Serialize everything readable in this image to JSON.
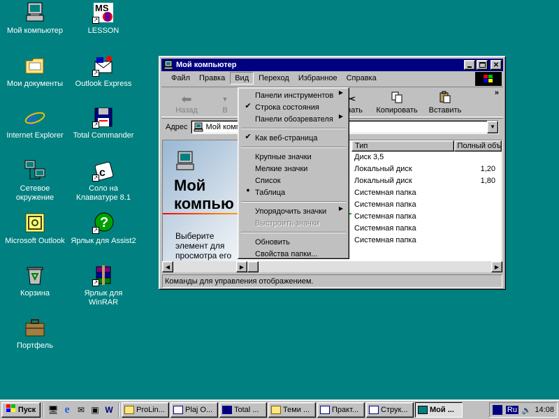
{
  "desktop": {
    "icons": [
      {
        "label": "Мой компьютер",
        "icon": "computer-icon"
      },
      {
        "label": "LESSON",
        "icon": "ms-office-icon"
      },
      {
        "label": "Мои документы",
        "icon": "folder-icon"
      },
      {
        "label": "Outlook Express",
        "icon": "outlook-express-icon"
      },
      {
        "label": "Internet Explorer",
        "icon": "ie-icon"
      },
      {
        "label": "Total Commander",
        "icon": "floppy-icon"
      },
      {
        "label": "Сетевое окружение",
        "icon": "network-icon"
      },
      {
        "label": "Соло на Клавиатуре 8.1",
        "icon": "keyboard-icon"
      },
      {
        "label": "Microsoft Outlook",
        "icon": "outlook-icon"
      },
      {
        "label": "Ярлык для Assist2",
        "icon": "help-icon"
      },
      {
        "label": "Корзина",
        "icon": "recycle-bin-icon"
      },
      {
        "label": "Ярлык для WinRAR",
        "icon": "winrar-icon"
      },
      {
        "label": "Портфель",
        "icon": "briefcase-icon"
      }
    ],
    "ms_logo_text": "MS"
  },
  "window": {
    "title": "Мой компьютер",
    "menu": [
      "Файл",
      "Правка",
      "Вид",
      "Переход",
      "Избранное",
      "Справка"
    ],
    "toolbar": {
      "back": "Назад",
      "forward_partial": "В",
      "cut_partial": "резать",
      "copy": "Копировать",
      "paste": "Вставить",
      "more": "»"
    },
    "address": {
      "label": "Адрес",
      "value": "Мой комп"
    },
    "webview": {
      "title_line1": "Мой",
      "title_line2": "компью",
      "desc": "Выберите элемент для просмотра его описания."
    },
    "list": {
      "columns": [
        "Тип",
        "Полный объ"
      ],
      "rows": [
        {
          "type": "Диск 3,5",
          "size": ""
        },
        {
          "type": "Локальный диск",
          "size": "1,20"
        },
        {
          "type": "Локальный диск",
          "size": "1,80"
        },
        {
          "type": "Системная папка",
          "size": ""
        },
        {
          "type": "Системная папка",
          "size": ""
        },
        {
          "type": "Системная папка",
          "size": ""
        },
        {
          "type": "Системная папка",
          "size": ""
        },
        {
          "type": "Системная папка",
          "size": ""
        }
      ]
    },
    "status": "Команды для управления отображением."
  },
  "view_menu": {
    "items": [
      {
        "label": "Панели инструментов",
        "mark": "",
        "submenu": true
      },
      {
        "label": "Строка состояния",
        "mark": "✔",
        "submenu": false
      },
      {
        "label": "Панели обозревателя",
        "mark": "",
        "submenu": true
      },
      {
        "sep": true
      },
      {
        "label": "Как веб-страница",
        "mark": "✔",
        "submenu": false
      },
      {
        "sep": true
      },
      {
        "label": "Крупные значки",
        "mark": "",
        "submenu": false
      },
      {
        "label": "Мелкие значки",
        "mark": "",
        "submenu": false
      },
      {
        "label": "Список",
        "mark": "",
        "submenu": false
      },
      {
        "label": "Таблица",
        "mark": "●",
        "submenu": false
      },
      {
        "sep": true
      },
      {
        "label": "Упорядочить значки",
        "mark": "",
        "submenu": true
      },
      {
        "label": "Выстроить значки",
        "mark": "",
        "submenu": false,
        "disabled": true
      },
      {
        "sep": true
      },
      {
        "label": "Обновить",
        "mark": "",
        "submenu": false
      },
      {
        "label": "Свойства папки...",
        "mark": "",
        "submenu": false
      }
    ]
  },
  "taskbar": {
    "start": "Пуск",
    "tasks": [
      "ProLin...",
      "Plaj O...",
      "Total ...",
      "Теми ...",
      "Практ...",
      "Струк...",
      "Мой ..."
    ],
    "active_task": 6,
    "lang": "Ru",
    "clock": "14:08"
  },
  "colors": {
    "desktop": "#008080",
    "titlebar": "#000080",
    "face": "#c0c0c0",
    "highlight": "#000080"
  }
}
